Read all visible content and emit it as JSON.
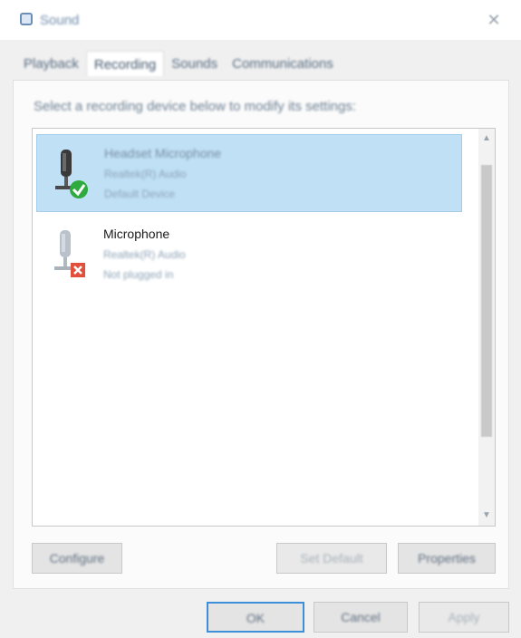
{
  "window": {
    "title": "Sound",
    "close_symbol": "✕",
    "app_icon": "sound-app-icon"
  },
  "tabs": [
    {
      "label": "Playback"
    },
    {
      "label": "Recording"
    },
    {
      "label": "Sounds"
    },
    {
      "label": "Communications"
    }
  ],
  "instruction": "Select a recording device below to modify its settings:",
  "devices": [
    {
      "name": "Headset Microphone",
      "line1": "Realtek(R) Audio",
      "line2": "Default Device",
      "status": "default",
      "selected": true
    },
    {
      "name": "Microphone",
      "line1": "Realtek(R) Audio",
      "line2": "Not plugged in",
      "status": "unplugged",
      "selected": false
    }
  ],
  "buttons": {
    "configure": "Configure",
    "set_default": "Set Default",
    "properties": "Properties",
    "ok": "OK",
    "cancel": "Cancel",
    "apply": "Apply"
  },
  "colors": {
    "selection": "#bfe0f5",
    "default_check": "#2eaa3f",
    "unplugged": "#e0503c"
  }
}
